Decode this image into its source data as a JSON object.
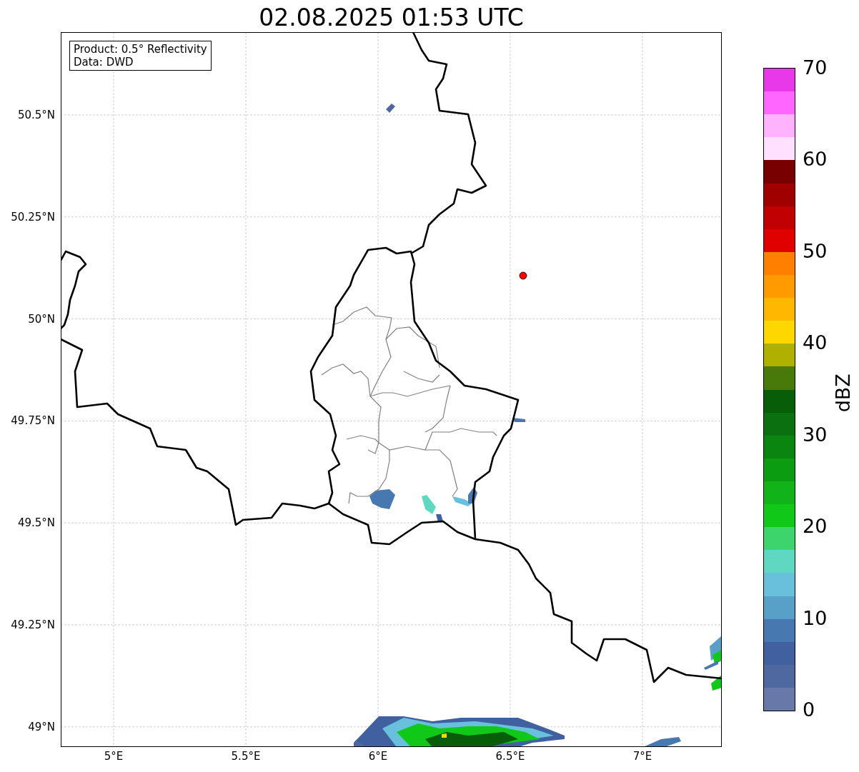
{
  "title": "02.08.2025 01:53 UTC",
  "info_box": [
    "Product: 0.5° Reflectivity",
    "Data: DWD"
  ],
  "map": {
    "lat_ticks": [
      "50.5°N",
      "50.25°N",
      "50°N",
      "49.75°N",
      "49.5°N",
      "49.25°N",
      "49°N"
    ],
    "lon_ticks": [
      "5°E",
      "5.5°E",
      "6°E",
      "6.5°E",
      "7°E"
    ]
  },
  "colorbar": {
    "label": "dBZ",
    "ticks": [
      "70",
      "60",
      "50",
      "40",
      "30",
      "20",
      "10",
      "0"
    ],
    "segments": [
      {
        "color": "#e838e8"
      },
      {
        "color": "#ff66ff"
      },
      {
        "color": "#ffb3ff"
      },
      {
        "color": "#ffe0ff"
      },
      {
        "color": "#780000"
      },
      {
        "color": "#a00000"
      },
      {
        "color": "#c00000"
      },
      {
        "color": "#e00000"
      },
      {
        "color": "#ff8000"
      },
      {
        "color": "#ff9a00"
      },
      {
        "color": "#ffb700"
      },
      {
        "color": "#ffd700"
      },
      {
        "color": "#b0b000"
      },
      {
        "color": "#487a0a"
      },
      {
        "color": "#085d08"
      },
      {
        "color": "#0a7010"
      },
      {
        "color": "#0a8510"
      },
      {
        "color": "#0c9c12"
      },
      {
        "color": "#10b418"
      },
      {
        "color": "#10c818"
      },
      {
        "color": "#3cd46c"
      },
      {
        "color": "#5ed8c0"
      },
      {
        "color": "#68c0dc"
      },
      {
        "color": "#58a0c8"
      },
      {
        "color": "#4878b0"
      },
      {
        "color": "#4060a0"
      },
      {
        "color": "#5068a0"
      },
      {
        "color": "#6878a8"
      }
    ]
  }
}
